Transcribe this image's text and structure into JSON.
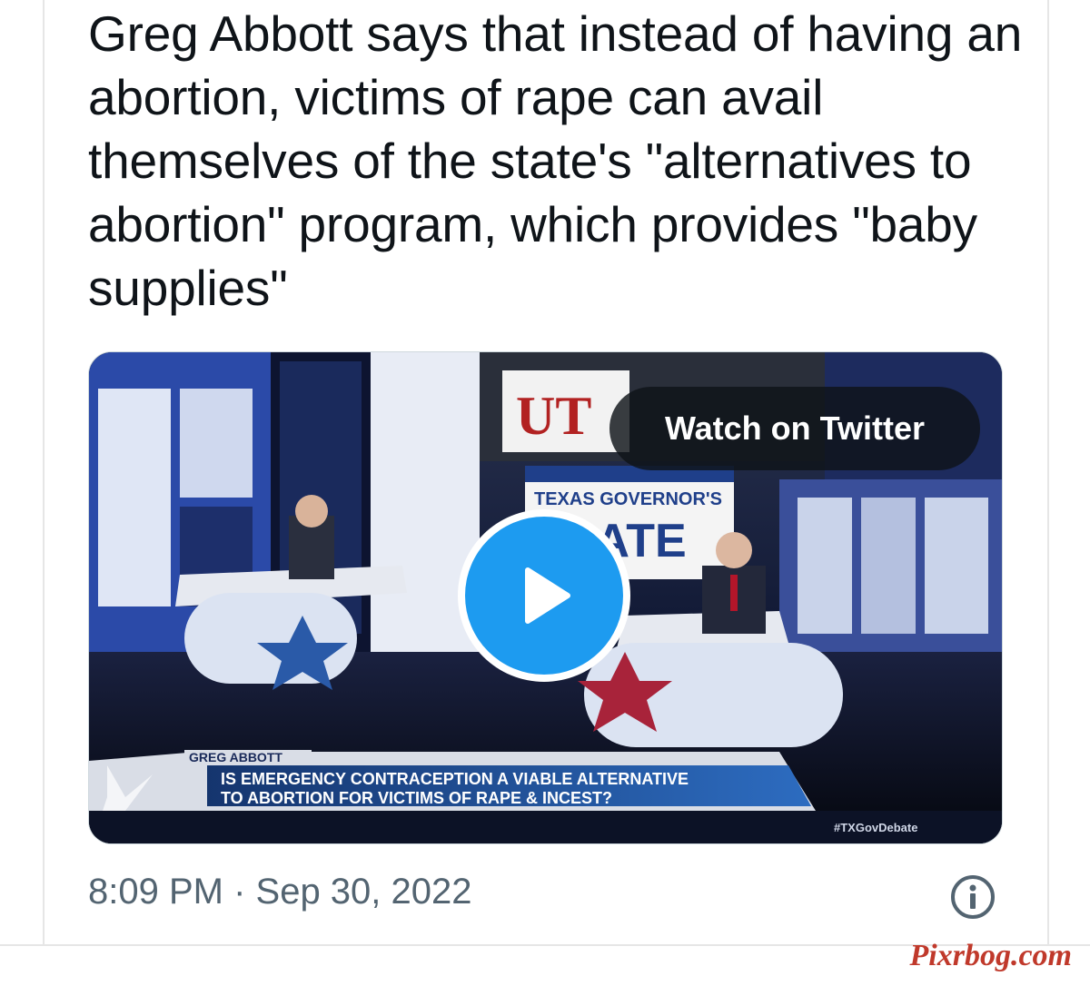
{
  "tweet": {
    "text": "Greg Abbott says that instead of having an abortion, victims of rape can avail themselves of the state's \"alternatives to abortion\" program, which provides \"baby supplies\"",
    "timestamp": "8:09 PM · Sep 30, 2022"
  },
  "media": {
    "watch_label": "Watch on Twitter",
    "set_sign_text": "UT",
    "banner_line1": "TEXAS GOVERNOR'S",
    "banner_line2": "BATE",
    "lower_third_name": "GREG ABBOTT",
    "lower_third_line1": "IS EMERGENCY CONTRACEPTION A VIABLE ALTERNATIVE",
    "lower_third_line2": "TO ABORTION FOR VICTIMS OF RAPE & INCEST?",
    "hashtag": "#TXGovDebate"
  },
  "icons": {
    "play": "play-icon",
    "info": "info-icon"
  },
  "watermark": "Pixrbog.com",
  "colors": {
    "play_blue": "#1d9bf0",
    "text": "#0f1419",
    "secondary_text": "#536471",
    "watermark": "#c0392b"
  }
}
